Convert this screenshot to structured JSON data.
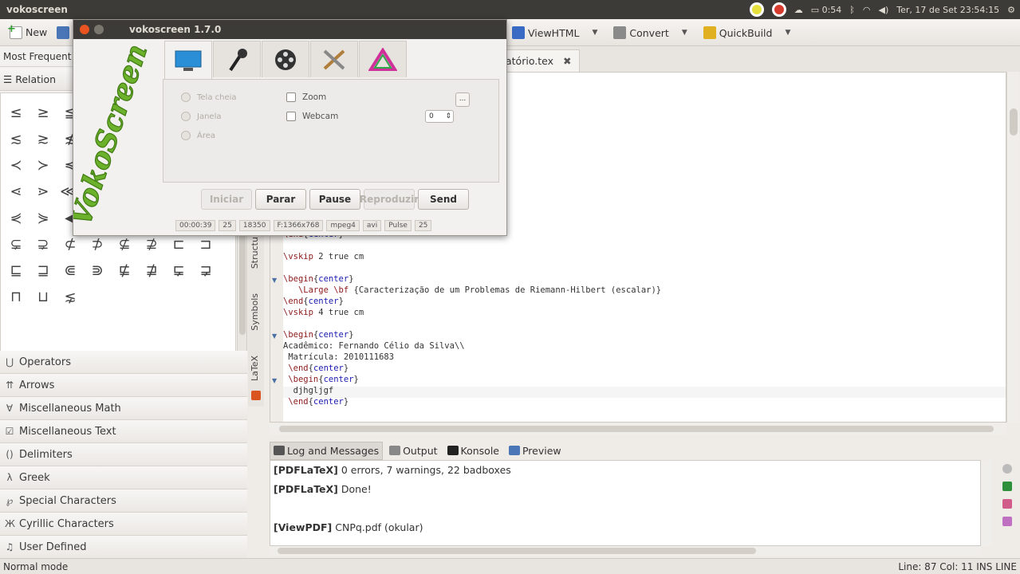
{
  "top_panel": {
    "app_title": "vokoscreen",
    "battery": "0:54",
    "datetime": "Ter, 17 de Set  23:54:15"
  },
  "toolbar": {
    "new_label": "New",
    "viewhtml_label": "ViewHTML",
    "convert_label": "Convert",
    "quickbuild_label": "QuickBuild"
  },
  "left_panel": {
    "most_frequent": "Most Frequent",
    "relation_header": "Relation",
    "symbols": [
      "≤",
      "≥",
      "≦",
      "≧",
      "≨",
      "≩",
      "≪",
      "≫",
      "≲",
      "≳",
      "≴",
      "≵",
      "≶",
      "≷",
      "≸",
      "≹",
      "≺",
      "≻",
      "≼",
      "≽",
      "≾",
      "≿",
      "⊀",
      "⊁",
      "⋖",
      "⋗",
      "⋘",
      "⋙",
      "⋚",
      "⋛",
      "⋜",
      "⋝",
      "⋞",
      "⋟",
      "◀",
      "▶",
      "⊂",
      "⊃",
      "⊆",
      "⊇",
      "⊊",
      "⊋",
      "⊄",
      "⊅",
      "⊈",
      "⊉",
      "⊏",
      "⊐",
      "⊑",
      "⊒",
      "⋐",
      "⋑",
      "⋢",
      "⋣",
      "⋤",
      "⋥",
      "⊓",
      "⊔",
      "⋦"
    ],
    "categories": [
      {
        "icon": "⋃",
        "label": "Operators"
      },
      {
        "icon": "⇈",
        "label": "Arrows"
      },
      {
        "icon": "∀",
        "label": "Miscellaneous Math"
      },
      {
        "icon": "☑",
        "label": "Miscellaneous Text"
      },
      {
        "icon": "()",
        "label": "Delimiters"
      },
      {
        "icon": "λ",
        "label": "Greek"
      },
      {
        "icon": "℘",
        "label": "Special Characters"
      },
      {
        "icon": "Ж",
        "label": "Cyrillic Characters"
      },
      {
        "icon": "♫",
        "label": "User Defined"
      }
    ]
  },
  "side_tabs": {
    "structure": "Structure",
    "symbols": "Symbols",
    "latex": "LaTeX"
  },
  "editor": {
    "tab_name": "atório.tex",
    "lines": [
      {
        "parts": [
          {
            "t": "\\end",
            "c": "kw"
          },
          {
            "t": "{",
            "c": ""
          },
          {
            "t": "center",
            "c": "env"
          },
          {
            "t": "}",
            "c": ""
          }
        ]
      },
      {
        "parts": [
          {
            "t": "",
            "c": ""
          }
        ]
      },
      {
        "parts": [
          {
            "t": "\\vskip",
            "c": "kw"
          },
          {
            "t": " 2 true cm",
            "c": ""
          }
        ]
      },
      {
        "parts": [
          {
            "t": "",
            "c": ""
          }
        ]
      },
      {
        "parts": [
          {
            "t": "\\begin",
            "c": "kw"
          },
          {
            "t": "{",
            "c": ""
          },
          {
            "t": "center",
            "c": "env"
          },
          {
            "t": "}",
            "c": ""
          }
        ]
      },
      {
        "parts": [
          {
            "t": "   \\Large \\bf",
            "c": "kw"
          },
          {
            "t": " {Caracterização de um Problemas de Riemann-Hilbert (escalar)}",
            "c": ""
          }
        ]
      },
      {
        "parts": [
          {
            "t": "\\end",
            "c": "kw"
          },
          {
            "t": "{",
            "c": ""
          },
          {
            "t": "center",
            "c": "env"
          },
          {
            "t": "}",
            "c": ""
          }
        ]
      },
      {
        "parts": [
          {
            "t": "\\vskip",
            "c": "kw"
          },
          {
            "t": " 4 true cm",
            "c": ""
          }
        ]
      },
      {
        "parts": [
          {
            "t": "",
            "c": ""
          }
        ]
      },
      {
        "parts": [
          {
            "t": "\\begin",
            "c": "kw"
          },
          {
            "t": "{",
            "c": ""
          },
          {
            "t": "center",
            "c": "env"
          },
          {
            "t": "}",
            "c": ""
          }
        ]
      },
      {
        "parts": [
          {
            "t": "Acadêmico: Fernando Célio da Silva\\\\",
            "c": ""
          }
        ]
      },
      {
        "parts": [
          {
            "t": " Matrícula: 2010111683",
            "c": ""
          }
        ]
      },
      {
        "parts": [
          {
            "t": " \\end",
            "c": "kw"
          },
          {
            "t": "{",
            "c": ""
          },
          {
            "t": "center",
            "c": "env"
          },
          {
            "t": "}",
            "c": ""
          }
        ]
      },
      {
        "parts": [
          {
            "t": " \\begin",
            "c": "kw"
          },
          {
            "t": "{",
            "c": ""
          },
          {
            "t": "center",
            "c": "env"
          },
          {
            "t": "}",
            "c": ""
          }
        ]
      },
      {
        "parts": [
          {
            "t": "  djhgljgf",
            "c": ""
          }
        ]
      },
      {
        "parts": [
          {
            "t": " \\end",
            "c": "kw"
          },
          {
            "t": "{",
            "c": ""
          },
          {
            "t": "center",
            "c": "env"
          },
          {
            "t": "}",
            "c": ""
          }
        ]
      }
    ]
  },
  "messages": {
    "tabs": [
      "Log and Messages",
      "Output",
      "Konsole",
      "Preview"
    ],
    "lines": [
      {
        "tag": "[PDFLaTeX]",
        "text": " 0 errors, 7 warnings, 22 badboxes"
      },
      {
        "tag": "[PDFLaTeX]",
        "text": " Done!"
      },
      {
        "tag": "[ViewPDF]",
        "text": " CNPq.pdf (okular)"
      }
    ]
  },
  "statusbar": {
    "mode": "Normal mode",
    "position": "Line: 87 Col: 11  INS  LINE"
  },
  "vokoscreen": {
    "title": "vokoscreen 1.7.0",
    "radios": [
      "Tela cheia",
      "Janela",
      "Área"
    ],
    "zoom_label": "Zoom",
    "webcam_label": "Webcam",
    "webcam_value": "0",
    "dots_label": "...",
    "buttons": [
      "Iniciar",
      "Parar",
      "Pause",
      "Reproduzir",
      "Send"
    ],
    "status": [
      "00:00:39",
      "25",
      "18350",
      "F:1366x768",
      "mpeg4",
      "avi",
      "Pulse",
      "25"
    ],
    "colors": {
      "logo": "#6cb12b",
      "tab_active": "#f2f1f0"
    }
  },
  "colors": {
    "ubuntu_panel": "#3c3b37",
    "keyword": "#8b1a1a",
    "environment": "#1a1ab0"
  }
}
